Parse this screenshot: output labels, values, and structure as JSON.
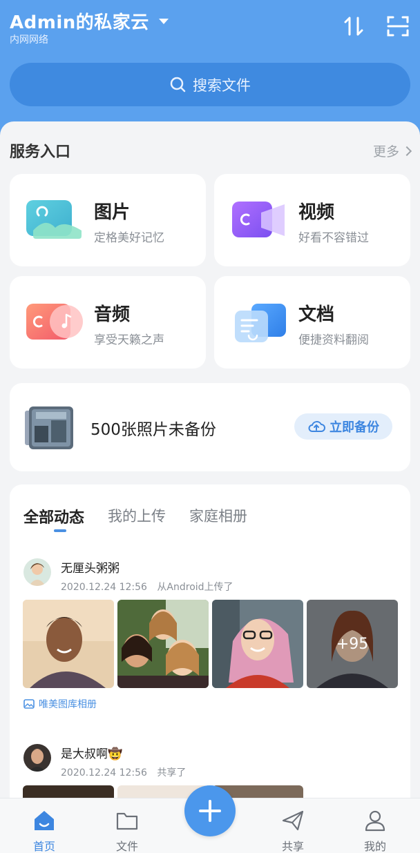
{
  "header": {
    "title": "Admin的私家云",
    "subtitle": "内网网络",
    "search_placeholder": "搜索文件"
  },
  "services": {
    "title": "服务入口",
    "more": "更多",
    "items": [
      {
        "title": "图片",
        "subtitle": "定格美好记忆",
        "icon": "image-icon"
      },
      {
        "title": "视频",
        "subtitle": "好看不容错过",
        "icon": "video-icon"
      },
      {
        "title": "音频",
        "subtitle": "享受天籁之声",
        "icon": "audio-icon"
      },
      {
        "title": "文档",
        "subtitle": "便捷资料翻阅",
        "icon": "document-icon"
      }
    ]
  },
  "backup": {
    "text": "500张照片未备份",
    "button": "立即备份"
  },
  "feed": {
    "tabs": [
      "全部动态",
      "我的上传",
      "家庭相册"
    ],
    "active_tab": 0,
    "posts": [
      {
        "user": "无厘头粥粥",
        "time": "2020.12.24 12:56",
        "action": "从Android上传了",
        "more_count": "+95",
        "album": "唯美图库相册"
      },
      {
        "user": "是大叔啊",
        "emoji": "🤠",
        "time": "2020.12.24 12:56",
        "action": "共享了"
      }
    ]
  },
  "bottom_nav": {
    "items": [
      "首页",
      "文件",
      "共享",
      "我的"
    ],
    "active": 0
  },
  "colors": {
    "header_blue": "#5ba1ee",
    "accent_blue": "#3d86e0"
  }
}
